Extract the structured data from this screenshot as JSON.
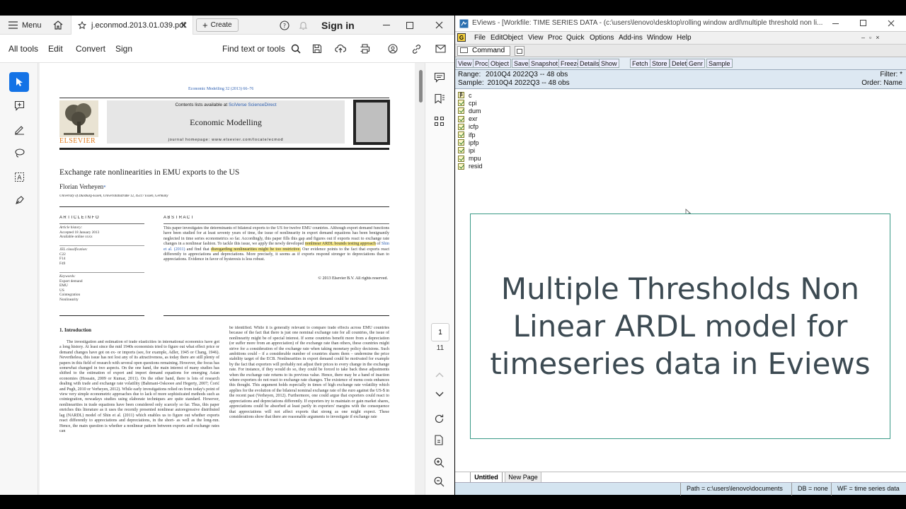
{
  "pdf": {
    "tabbar": {
      "menu_label": "Menu",
      "tab_title": "j.econmod.2013.01.039.pdf",
      "create_label": "Create",
      "sign_in": "Sign in"
    },
    "toolbar": {
      "all_tools": "All tools",
      "edit": "Edit",
      "convert": "Convert",
      "sign": "Sign",
      "find": "Find text or tools"
    },
    "page_nav": {
      "current": "1",
      "total": "11"
    },
    "paper": {
      "journal_ref": "Economic Modelling 32 (2013) 66–76",
      "contents_prefix": "Contents lists available at ",
      "contents_link": "SciVerse ScienceDirect",
      "journal_name": "Economic Modelling",
      "homepage": "journal homepage: www.elsevier.com/locate/ecmod",
      "publisher": "ELSEVIER",
      "title": "Exchange rate nonlinearities in EMU exports to the US",
      "author": "Florian Verheyen",
      "author_mark": "⁎",
      "affiliation": "University of Duisburg-Essen, Universitätsstraße 12, 45117 Essen, Germany",
      "article_info_head": "A R T I C L E   I N F O",
      "abstract_head": "A B S T R A C T",
      "history": [
        "Article history:",
        "Accepted 18 January 2013",
        "Available online xxxx"
      ],
      "jel": [
        "JEL classification:",
        "C22",
        "F14",
        "F49"
      ],
      "keywords": [
        "Keywords:",
        "Export demand",
        "EMU",
        "US",
        "Cointegration",
        "Nonlinearity"
      ],
      "abstract_1": "This paper investigates the determinants of bilateral exports to the US for twelve EMU countries. Although export demand functions have been studied for at least seventy years of time, the issue of nonlinearity in export demand equations has been benignantly neglected in time series econometrics so far. Accordingly, this paper fills this gap and figures out if exports react to exchange rate changes in a nonlinear fashion. To tackle this issue, we apply the newly developed ",
      "abstract_hl1": "nonlinear ARDL bounds testing approach",
      "abstract_2": " of ",
      "abstract_link": "Shin et al. (2011)",
      "abstract_3": " and find that ",
      "abstract_hl2": "disregarding nonlinearities might be too restrictive.",
      "abstract_4": " Our evidence points to the fact that exports react differently to appreciations and depreciations. More precisely, it seems as if exports respond stronger to depreciations than to appreciations. Evidence in favor of hysteresis is less robust.",
      "copyright": "© 2013 Elsevier B.V. All rights reserved.",
      "intro_head": "1. Introduction",
      "col1": "The investigation and estimation of trade elasticities in international economics have got a long history. At least since the mid 1940s economists tried to figure out what effect price or demand changes have got on ex- or imports (see, for example, Adler, 1945 or Chang, 1946). Nevertheless, this issue has not lost any of its attractiveness, as today there are still plenty of papers in this field of research with several open questions remaining. However, the focus has somewhat changed in two aspects. On the one hand, the main interest of many studies has shifted to the estimation of export and import demand equations for emerging Asian economies (Hossain, 2009 or Kumar, 2011). On the other hand, there is lots of research dealing with trade and exchange rate volatility (Bahmani-Oskooee and Hegerty, 2007; Ćorić and Pugh, 2010 or Verheyen, 2012). While early investigations relied on from today's point of view very simple econometric approaches due to lack of more sophisticated methods such as cointegration, nowadays studies using elaborate techniques are quite standard. However, nonlinearities in trade equations have been considered only scarcely so far. Thus, this paper enriches this literature as it uses the recently presented nonlinear autoregressive distributed lag (NARDL) model of Shin et al. (2011) which enables us to figure out whether exports react differently to appreciations and depreciations, in the short- as well as the long-run. Hence, the main question is whether a nonlinear pattern between exports and exchange rates can",
      "col2": "be identified. While it is generally relevant to compare trade effects across EMU countries because of the fact that there is just one nominal exchange rate for all countries, the issue of nonlinearity might be of special interest. If some countries benefit more from a depreciation (or suffer more from an appreciation) of the exchange rate than others, these countries might strive for a consideration of the exchange rate when taking monetary policy decisions. Such ambitions could – if a considerable number of countries shares them – undermine the price stability target of the ECB. Nonlinearities in export demand could be motivated for example by the fact that exporters will probably not adjust their prices to every change in the exchange rate. For instance, if they would do so, they could be forced to take back these adjustments when the exchange rate returns to its previous value. Hence, there may be a band of inaction where exporters do not react to exchange rate changes. The existence of menu costs enhances this thought. This argument holds especially in times of high exchange rate volatility which applies for the evolution of the bilateral nominal exchange rate of the euro against the US-$ in the recent past (Verheyen, 2012). Furthermore, one could argue that exporters could react to appreciations and depreciations differently. If exporters try to maintain or gain market shares, appreciations could be absorbed at least partly in exporters' margins with the consequence that appreciations will not affect exports that strong as one might expect. These considerations show that there are reasonable arguments to investigate if exchange rate"
    }
  },
  "eviews": {
    "title": "EViews - [Workfile: TIME SERIES DATA - (c:\\users\\lenovo\\desktop\\rolling window ardl\\multiple threshold non li...",
    "menu": [
      "File",
      "Edit",
      "Object",
      "View",
      "Proc",
      "Quick",
      "Options",
      "Add-ins",
      "Window",
      "Help"
    ],
    "command_label": "Command",
    "wf_buttons": [
      "View",
      "Proc",
      "Object",
      "Save",
      "Snapshot",
      "Freeze",
      "Details+/-",
      "Show",
      "Fetch",
      "Store",
      "Delete",
      "Genr",
      "Sample"
    ],
    "range_label": "Range:",
    "range_value": "2010Q4 2022Q3  --  48 obs",
    "sample_label": "Sample:",
    "sample_value": "2010Q4 2022Q3  --  48 obs",
    "filter": "Filter: *",
    "order": "Order: Name",
    "objects": [
      "c",
      "cpi",
      "dum",
      "exr",
      "icfp",
      "ifp",
      "ipfp",
      "ipi",
      "mpu",
      "resid"
    ],
    "overlay_text": "Multiple Thresholds Non Linear ARDL model for timeseries data in Eviews",
    "page_tabs": [
      "Untitled",
      "New Page"
    ],
    "status": {
      "path": "Path = c:\\users\\lenovo\\documents",
      "db": "DB = none",
      "wf": "WF = time series data"
    }
  },
  "colors": {
    "acrobat_blue": "#1473e6",
    "overlay_border": "#3a9a86",
    "highlight": "#f7e98a",
    "eviews_bg": "#d4e4f0"
  }
}
